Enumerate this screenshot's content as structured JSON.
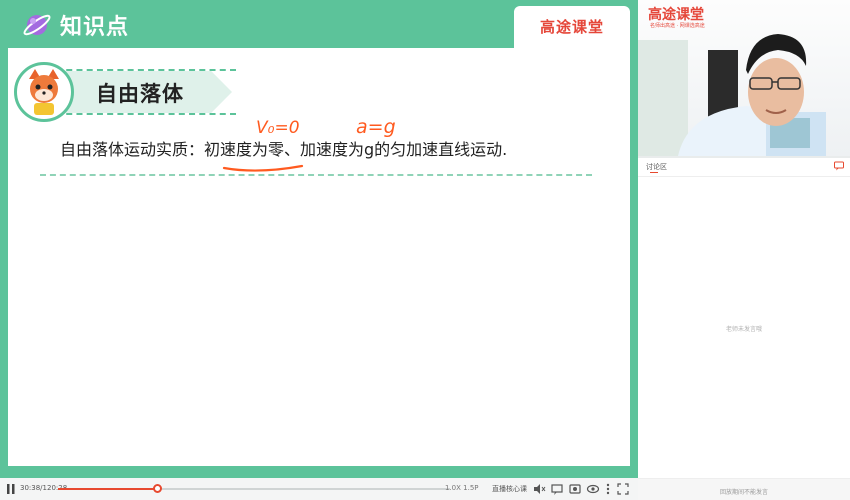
{
  "slide": {
    "title": "知识点",
    "brand": "高途课堂",
    "section_badge": "自由落体",
    "body_text": "自由落体运动实质：初速度为零、加速度为g的匀加速直线运动.",
    "annotation_1": "V₀=0",
    "annotation_2": "a=g"
  },
  "player": {
    "time": "30:38/120:28",
    "progress_fraction": 0.256,
    "speed": "1.0X",
    "speed_value": "1.5P",
    "key_clip_label": "直播核心课"
  },
  "video": {
    "logo": "高途课堂",
    "slogan": "名师出高途 · 网课选高途"
  },
  "chat": {
    "title": "讨论区",
    "empty_text": "老师未发言哦",
    "input_placeholder": "回放期间不能发言"
  },
  "colors": {
    "accent_green": "#5cc39a",
    "brand_red": "#e5473a",
    "progress_red": "#e7492f",
    "ink_orange": "#ff5a1f"
  }
}
